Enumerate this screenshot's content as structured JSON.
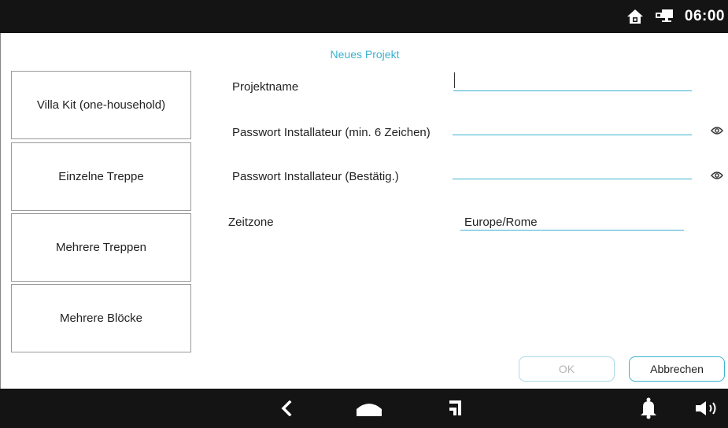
{
  "status_bar": {
    "time": "06:00",
    "icons": [
      "home-lock-icon",
      "network-icon"
    ]
  },
  "form": {
    "title": "Neues Projekt",
    "fields": [
      {
        "label": "Projektname",
        "value": ""
      },
      {
        "label": "Passwort Installateur (min. 6 Zeichen)",
        "value": ""
      },
      {
        "label": "Passwort Installateur (Bestätig.)",
        "value": ""
      },
      {
        "label": "Zeitzone",
        "value": "Europe/Rome"
      }
    ]
  },
  "templates": [
    {
      "label": "Villa Kit (one-household)"
    },
    {
      "label": "Einzelne Treppe"
    },
    {
      "label": "Mehrere Treppen"
    },
    {
      "label": "Mehrere Blöcke"
    }
  ],
  "actions": {
    "ok_label": "OK",
    "cancel_label": "Abbrechen"
  },
  "nav_bar": {
    "icons": [
      "back-icon",
      "home-icon",
      "recent-icon",
      "bell-icon",
      "volume-icon"
    ]
  },
  "colors": {
    "accent": "#3bb2cf",
    "bar_background": "#141414"
  }
}
